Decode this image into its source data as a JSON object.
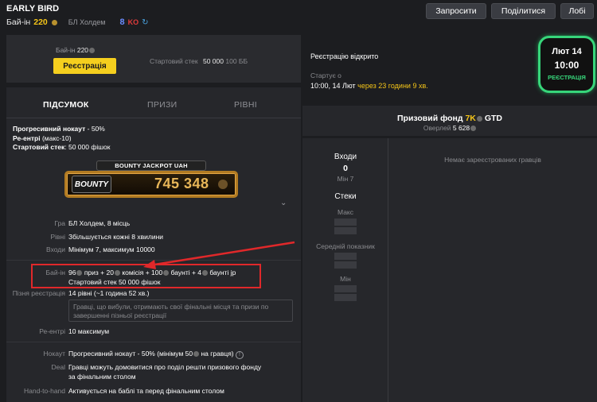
{
  "header": {
    "title": "EARLY BIRD",
    "buyin_label": "Бай-ін",
    "buyin_amount": "220",
    "game": "БЛ Холдем",
    "ko_count": "8",
    "ko_badge": "KO",
    "buttons": {
      "register": "Запросити",
      "share": "Поділитися",
      "lobby": "Лобі"
    }
  },
  "registration_box": {
    "buyin_label": "Бай-ін",
    "buyin_amount": "220",
    "button": "Реєстрація",
    "start_stack_label": "Стартовий стек",
    "start_stack_value": "50 000",
    "start_stack_bb": "100 ББ"
  },
  "tabs": {
    "summary": "ПІДСУМОК",
    "prizes": "ПРИЗИ",
    "levels": "РІВНІ"
  },
  "summary": {
    "line1_label": "Прогресивний нокаут",
    "line1_value": " - 50%",
    "line2_label": "Ре-ентрі",
    "line2_value": " (макс-10)",
    "line3_label": "Стартовий стек",
    "line3_value": ": 50 000 фішок"
  },
  "jackpot": {
    "title": "BOUNTY JACKPOT UAH",
    "logo": "BOUNTY",
    "value": "745 348"
  },
  "details": {
    "game_label": "Гра",
    "game_value": "БЛ Холдем, 8 місць",
    "levels_label": "Рівні",
    "levels_value": "Збільшується кожні 8 хвилини",
    "entries_label": "Входи",
    "entries_value": "Мінімум 7, максимум 10000",
    "buyin_label": "Бай-ін",
    "buyin_p1": "96",
    "buyin_p2": " приз + 20",
    "buyin_p3": " комісія + 100",
    "buyin_p4": " баунті + 4",
    "buyin_p5": " баунті jp",
    "buyin_line2": "Стартовий стек 50 000 фішок",
    "late_label": "Пізня реєстрація",
    "late_value": "14 рівні (~1 година 52 хв.)",
    "late_note": "Гравці, що вибули, отримають свої фінальні місця та призи по завершенні пізньої реєстрації",
    "reentry_label": "Ре-ентрі",
    "reentry_value": "10 максимум",
    "knockout_label": "Нокаут",
    "knockout_value_a": "Прогресивний нокаут - 50% (мінімум 50",
    "knockout_value_b": " на гравця)",
    "deal_label": "Deal",
    "deal_value_1": "Гравці можуть домовитися про поділ решти призового фонду",
    "deal_value_2": "за фінальним столом",
    "hth_label": "Hand-to-hand",
    "hth_value": "Активується на баблі та перед фінальним столом"
  },
  "status": {
    "open": "Реєстрацію відкрито",
    "start_label": "Стартує о",
    "start_time": "10:00, 14 Лют",
    "start_rel": "через 23 години 9 хв."
  },
  "date_badge": {
    "date": "Лют 14",
    "time": "10:00",
    "label": "РЕЄСТРАЦІЯ"
  },
  "prize_pool": {
    "label": "Призовий фонд",
    "amount": "7K",
    "gtd": "GTD",
    "overlay_label": "Оверлей",
    "overlay_value": "5 628"
  },
  "stats": {
    "entries_title": "Входи",
    "entries_value": "0",
    "entries_min": "Мін 7",
    "stacks_title": "Стеки",
    "max_label": "Макс",
    "avg_label": "Середній показник",
    "min_label": "Мін"
  },
  "players": {
    "empty": "Немає зареєстрованих гравців"
  },
  "colors": {
    "accent": "#f5cf1e",
    "green": "#37d67a",
    "highlight": "#e0282a"
  }
}
